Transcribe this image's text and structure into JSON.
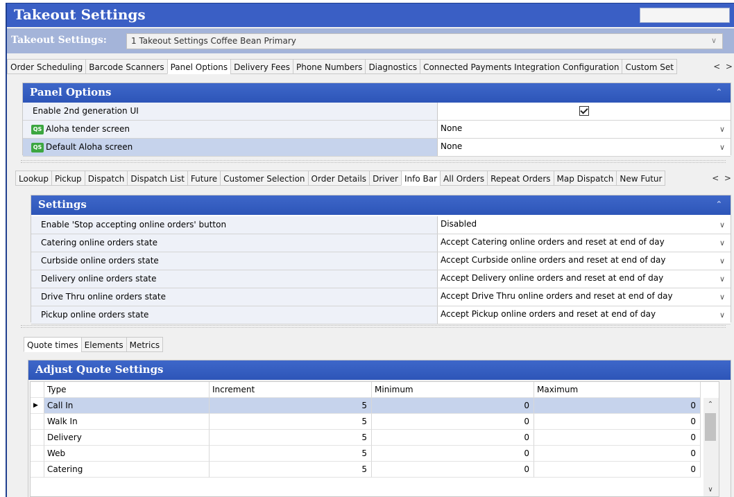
{
  "window": {
    "title": "Takeout Settings"
  },
  "selector": {
    "label": "Takeout Settings:",
    "value": "1 Takeout Settings Coffee Bean Primary"
  },
  "top_tabs": [
    "Order Scheduling",
    "Barcode Scanners",
    "Panel Options",
    "Delivery Fees",
    "Phone Numbers",
    "Diagnostics",
    "Connected Payments Integration Configuration",
    "Custom Set"
  ],
  "top_tabs_active": "Panel Options",
  "panel_options": {
    "title": "Panel Options",
    "rows": [
      {
        "label": "Enable 2nd generation UI",
        "value": "",
        "checked": true
      },
      {
        "label": "Aloha tender screen",
        "value": "None",
        "icon": "QS"
      },
      {
        "label": "Default Aloha screen",
        "value": "None",
        "icon": "QS"
      }
    ]
  },
  "sub_tabs": [
    "Lookup",
    "Pickup",
    "Dispatch",
    "Dispatch List",
    "Future",
    "Customer Selection",
    "Order Details",
    "Driver",
    "Info Bar",
    "All Orders",
    "Repeat Orders",
    "Map Dispatch",
    "New Futur"
  ],
  "sub_tabs_active": "Info Bar",
  "settings": {
    "title": "Settings",
    "rows": [
      {
        "label": "Enable 'Stop accepting online orders' button",
        "value": "Disabled"
      },
      {
        "label": "Catering online orders state",
        "value": "Accept Catering online orders and reset at end of day"
      },
      {
        "label": "Curbside online orders state",
        "value": "Accept Curbside online orders and reset at end of day"
      },
      {
        "label": "Delivery online orders state",
        "value": "Accept Delivery online orders and reset at end of day"
      },
      {
        "label": "Drive Thru online orders state",
        "value": "Accept Drive Thru online orders and reset at end of day"
      },
      {
        "label": "Pickup online orders state",
        "value": "Accept Pickup online orders and reset at end of day"
      }
    ]
  },
  "inner_tabs": [
    "Quote times",
    "Elements",
    "Metrics"
  ],
  "inner_tabs_active": "Quote times",
  "quote": {
    "title": "Adjust Quote Settings",
    "columns": [
      "Type",
      "Increment",
      "Minimum",
      "Maximum"
    ],
    "rows": [
      [
        "Call In",
        "5",
        "0",
        "0"
      ],
      [
        "Walk In",
        "5",
        "0",
        "0"
      ],
      [
        "Delivery",
        "5",
        "0",
        "0"
      ],
      [
        "Web",
        "5",
        "0",
        "0"
      ],
      [
        "Catering",
        "5",
        "0",
        "0"
      ]
    ]
  },
  "icons": {
    "collapse": "double-chevron-up-icon",
    "dropdown": "chevron-down-icon",
    "quick_service": "qs-icon",
    "row_pointer": "row-pointer-icon"
  },
  "colors": {
    "header_blue": "#2d55b8",
    "title_blue": "#3a5fc5",
    "selected_row": "#c6d3ec"
  }
}
